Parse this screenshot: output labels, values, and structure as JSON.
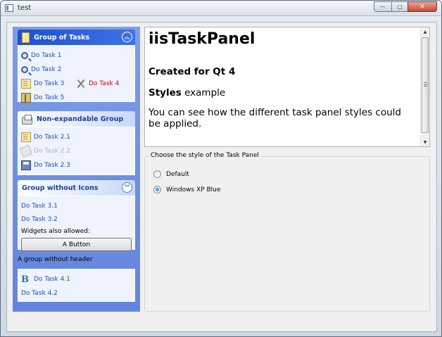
{
  "window": {
    "title": "test",
    "buttons": {
      "minimize": "—",
      "maximize": "▢",
      "close": "✕"
    }
  },
  "taskpanel": {
    "groups": [
      {
        "title": "Group of Tasks",
        "expanded": true,
        "items": [
          {
            "label": "Do Task 1",
            "icon": "zoom-icon"
          },
          {
            "label": "Do Task 2",
            "icon": "zoom-icon"
          },
          {
            "label": "Do Task 3",
            "icon": "document-icon"
          },
          {
            "label": "Do Task 4",
            "icon": "tools-icon",
            "color": "#d60000"
          },
          {
            "label": "Do Task 5",
            "icon": "book-icon"
          }
        ]
      },
      {
        "title": "Non-expandable Group",
        "items": [
          {
            "label": "Do Task 2.1",
            "icon": "document-icon"
          },
          {
            "label": "Do Task 2.2",
            "icon": "document-icon",
            "disabled": true
          },
          {
            "label": "Do Task 2.3",
            "icon": "disk-icon"
          }
        ]
      },
      {
        "title": "Group without Icons",
        "items": [
          {
            "label": "Do Task 3.1"
          },
          {
            "label": "Do Task 3.2"
          }
        ],
        "widgets_label": "Widgets also allowed:",
        "button_label": "A Button"
      },
      {
        "caption": "A group without header",
        "items": [
          {
            "label": "Do Task 4.1",
            "icon": "bold-icon"
          },
          {
            "label": "Do Task 4.2"
          }
        ]
      }
    ]
  },
  "textview": {
    "heading": "iisTaskPanel",
    "subheading": "Created for Qt 4",
    "styles_bold": "Styles",
    "styles_rest": " example",
    "paragraph": "You can see how the different task panel styles could be applied."
  },
  "stylebox": {
    "title": "Choose the style of the Task Panel",
    "options": [
      {
        "label": "Default",
        "checked": false
      },
      {
        "label": "Windows XP Blue",
        "checked": true
      }
    ]
  },
  "colors": {
    "panel_bg": "#6b8de1",
    "header_dark": "#1f4fd0",
    "link": "#1d4fbf",
    "link_alt": "#d60000"
  }
}
